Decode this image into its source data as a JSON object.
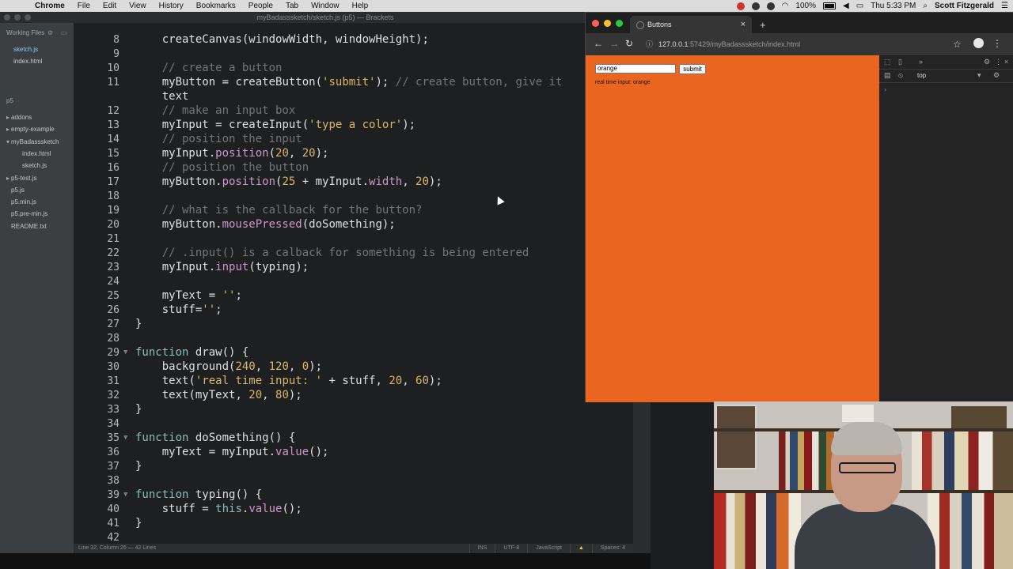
{
  "menubar": {
    "app": "Chrome",
    "items": [
      "File",
      "Edit",
      "View",
      "History",
      "Bookmarks",
      "People",
      "Tab",
      "Window",
      "Help"
    ],
    "battery": "100%",
    "clock": "Thu 5:33 PM",
    "user": "Scott Fitzgerald"
  },
  "editor": {
    "window_title": "myBadasssketch/sketch.js (p5) — Brackets",
    "working_files_label": "Working Files",
    "working_files": [
      "sketch.js",
      "index.html"
    ],
    "project_label": "p5",
    "tree": [
      {
        "label": "addons",
        "indent": 0,
        "arrow": "▸"
      },
      {
        "label": "empty-example",
        "indent": 0,
        "arrow": "▸"
      },
      {
        "label": "myBadasssketch",
        "indent": 0,
        "arrow": "▾"
      },
      {
        "label": "index.html",
        "indent": 1,
        "arrow": ""
      },
      {
        "label": "sketch.js",
        "indent": 1,
        "arrow": ""
      },
      {
        "label": "p5-test.js",
        "indent": 0,
        "arrow": "▸"
      },
      {
        "label": "p5.js",
        "indent": 0,
        "arrow": ""
      },
      {
        "label": "p5.min.js",
        "indent": 0,
        "arrow": ""
      },
      {
        "label": "p5.pre-min.js",
        "indent": 0,
        "arrow": ""
      },
      {
        "label": "README.txt",
        "indent": 0,
        "arrow": ""
      }
    ],
    "lines": [
      {
        "n": "8",
        "text": "    createCanvas(windowWidth, windowHeight);"
      },
      {
        "n": "9",
        "text": ""
      },
      {
        "n": "10",
        "text": "    // create a button"
      },
      {
        "n": "11",
        "text": "    myButton = createButton('submit'); // create button, give it"
      },
      {
        "n": "",
        "text": "    text"
      },
      {
        "n": "12",
        "text": "    // make an input box"
      },
      {
        "n": "13",
        "text": "    myInput = createInput('type a color');"
      },
      {
        "n": "14",
        "text": "    // position the input"
      },
      {
        "n": "15",
        "text": "    myInput.position(20, 20);"
      },
      {
        "n": "16",
        "text": "    // position the button"
      },
      {
        "n": "17",
        "text": "    myButton.position(25 + myInput.width, 20);"
      },
      {
        "n": "18",
        "text": ""
      },
      {
        "n": "19",
        "text": "    // what is the callback for the button?"
      },
      {
        "n": "20",
        "text": "    myButton.mousePressed(doSomething);"
      },
      {
        "n": "21",
        "text": ""
      },
      {
        "n": "22",
        "text": "    // .input() is a calback for something is being entered"
      },
      {
        "n": "23",
        "text": "    myInput.input(typing);"
      },
      {
        "n": "24",
        "text": ""
      },
      {
        "n": "25",
        "text": "    myText = '';"
      },
      {
        "n": "26",
        "text": "    stuff='';"
      },
      {
        "n": "27",
        "text": "}"
      },
      {
        "n": "28",
        "text": ""
      },
      {
        "n": "29",
        "text": "function draw() {"
      },
      {
        "n": "30",
        "text": "    background(240, 120, 0);"
      },
      {
        "n": "31",
        "text": "    text('real time input: ' + stuff, 20, 60);"
      },
      {
        "n": "32",
        "text": "    text(myText, 20, 80);"
      },
      {
        "n": "33",
        "text": "}"
      },
      {
        "n": "34",
        "text": ""
      },
      {
        "n": "35",
        "text": "function doSomething() {"
      },
      {
        "n": "36",
        "text": "    myText = myInput.value();"
      },
      {
        "n": "37",
        "text": "}"
      },
      {
        "n": "38",
        "text": ""
      },
      {
        "n": "39",
        "text": "function typing() {"
      },
      {
        "n": "40",
        "text": "    stuff = this.value();"
      },
      {
        "n": "41",
        "text": "}"
      },
      {
        "n": "42",
        "text": ""
      }
    ],
    "status_left": "Line 32, Column 26 — 42 Lines",
    "status_ins": "INS",
    "status_enc": "UTF-8",
    "status_lang": "JavaScript",
    "status_spaces": "Spaces: 4"
  },
  "browser": {
    "tab_title": "Buttons",
    "url_host": "127.0.0.1",
    "url_path": ":57429/myBadasssketch/index.html",
    "devtools_context": "top"
  },
  "sketch": {
    "input_value": "orange",
    "button_label": "submit",
    "realtime_text": "real time input: orange",
    "background_color": "#ea6520"
  }
}
